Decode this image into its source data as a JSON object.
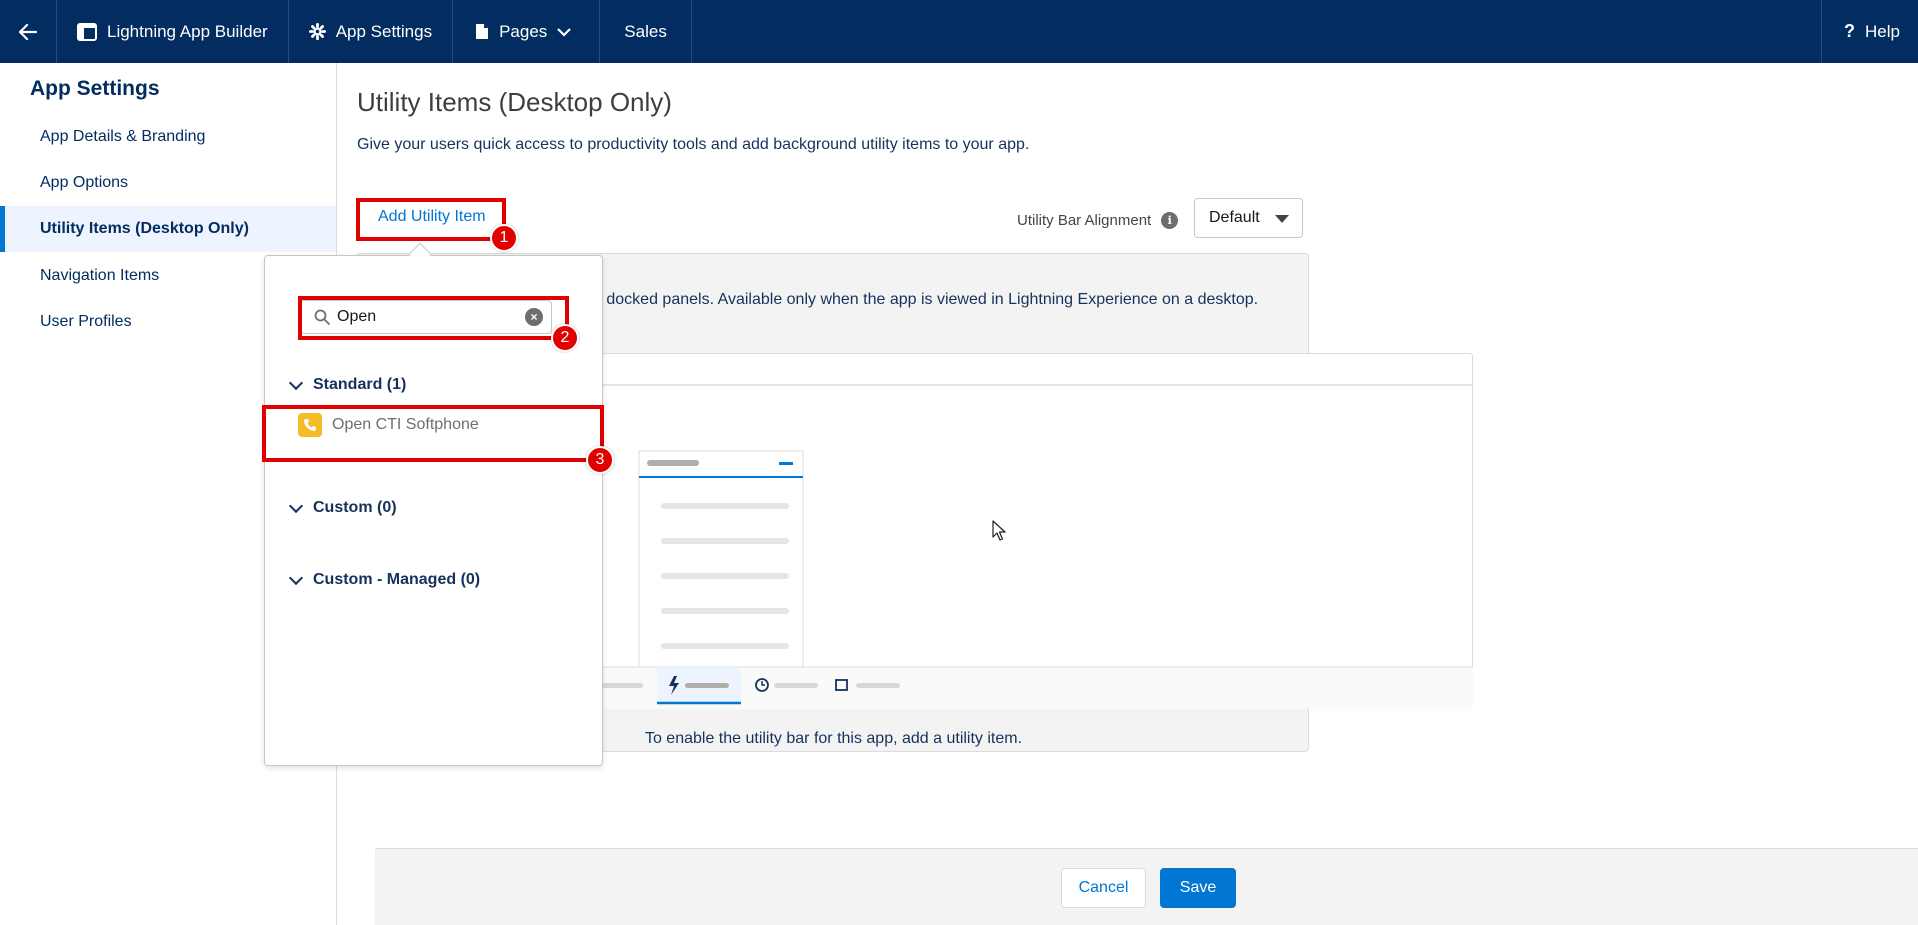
{
  "topbar": {
    "app_builder_label": "Lightning App Builder",
    "app_settings_label": "App Settings",
    "pages_label": "Pages",
    "app_name": "Sales",
    "help_label": "Help"
  },
  "sidebar": {
    "title": "App Settings",
    "items": [
      {
        "label": "App Details & Branding"
      },
      {
        "label": "App Options"
      },
      {
        "label": "Utility Items (Desktop Only)"
      },
      {
        "label": "Navigation Items"
      },
      {
        "label": "User Profiles"
      }
    ],
    "active_index": 2
  },
  "main": {
    "title": "Utility Items (Desktop Only)",
    "description": "Give your users quick access to productivity tools and add background utility items to your app.",
    "add_button": "Add Utility Item",
    "alignment_label": "Utility Bar Alignment",
    "alignment_value": "Default",
    "empty_description": "r that opens components in docked panels. Available only when the app is viewed in Lightning Experience on a desktop.",
    "empty_footer": "To enable the utility bar for this app, add a utility item."
  },
  "popover": {
    "search_value": "Open",
    "groups": [
      {
        "label": "Standard (1)"
      },
      {
        "label": "Custom (0)"
      },
      {
        "label": "Custom - Managed (0)"
      }
    ],
    "results": [
      {
        "label": "Open CTI Softphone"
      }
    ]
  },
  "annotations": {
    "step1": "1",
    "step2": "2",
    "step3": "3"
  },
  "footer": {
    "cancel_label": "Cancel",
    "save_label": "Save"
  },
  "colors": {
    "header_bg": "#032d60",
    "brand_blue": "#0176d3",
    "annotation_red": "#e00000",
    "softphone_icon": "#f4bc25"
  }
}
